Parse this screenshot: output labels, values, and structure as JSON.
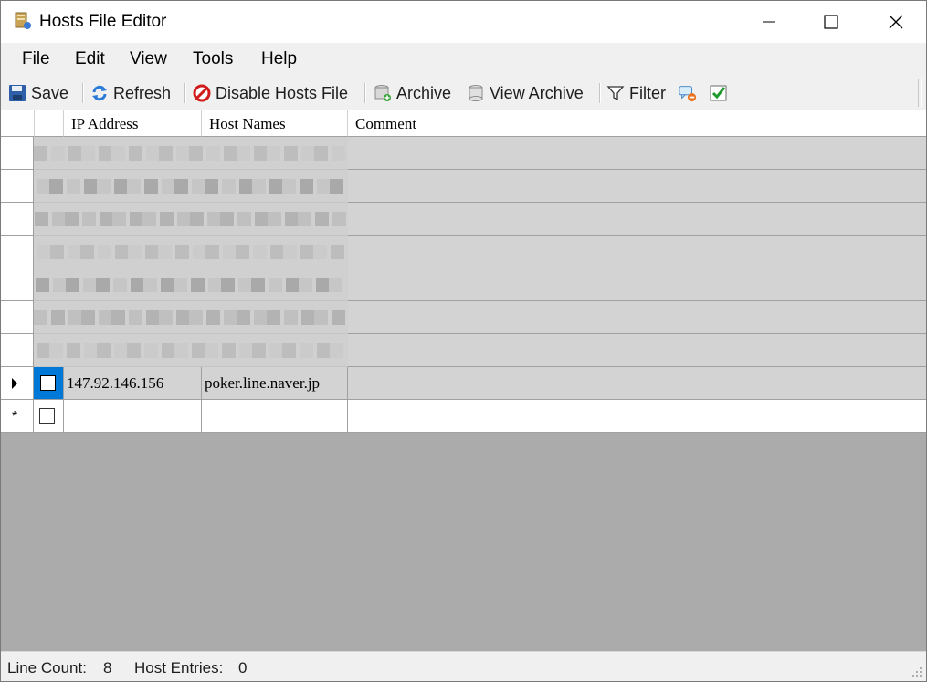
{
  "window": {
    "title": "Hosts File Editor"
  },
  "menu": [
    "File",
    "Edit",
    "View",
    "Tools",
    "Help"
  ],
  "toolbar": {
    "save": "Save",
    "refresh": "Refresh",
    "disable": "Disable Hosts File",
    "archive": "Archive",
    "view_archive": "View Archive",
    "filter": "Filter"
  },
  "grid": {
    "columns": [
      "IP Address",
      "Host Names",
      "Comment"
    ],
    "selected_row": {
      "ip": "147.92.146.156",
      "host": "poker.line.naver.jp",
      "comment": "",
      "checked": false
    },
    "new_row_marker": "*"
  },
  "status": {
    "line_count_label": "Line Count:",
    "line_count": "8",
    "host_entries_label": "Host Entries:",
    "host_entries": "0"
  },
  "colors": {
    "grid_bg": "#ababab",
    "row_bg": "#d3d3d3",
    "selection": "#0078d7"
  }
}
